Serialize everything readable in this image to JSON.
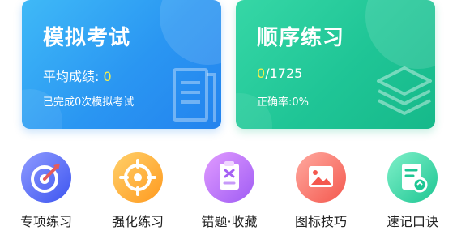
{
  "cards": {
    "exam": {
      "title": "模拟考试",
      "avg_label": "平均成绩: ",
      "avg_value": "0",
      "completed_text": "已完成0次模拟考试"
    },
    "order": {
      "title": "顺序练习",
      "progress_done": "0",
      "progress_total": "/1725",
      "accuracy_text": "正确率:0%"
    }
  },
  "nav": [
    {
      "label": "专项练习",
      "icon": "target-icon"
    },
    {
      "label": "强化练习",
      "icon": "crosshair-icon"
    },
    {
      "label": "错题·收藏",
      "icon": "wrong-questions-icon"
    },
    {
      "label": "图标技巧",
      "icon": "picture-icon"
    },
    {
      "label": "速记口诀",
      "icon": "mnemonic-book-icon"
    }
  ],
  "colors": {
    "exam_card": "#2a96f2",
    "order_card": "#1fc596",
    "highlight": "#f6f04a"
  }
}
